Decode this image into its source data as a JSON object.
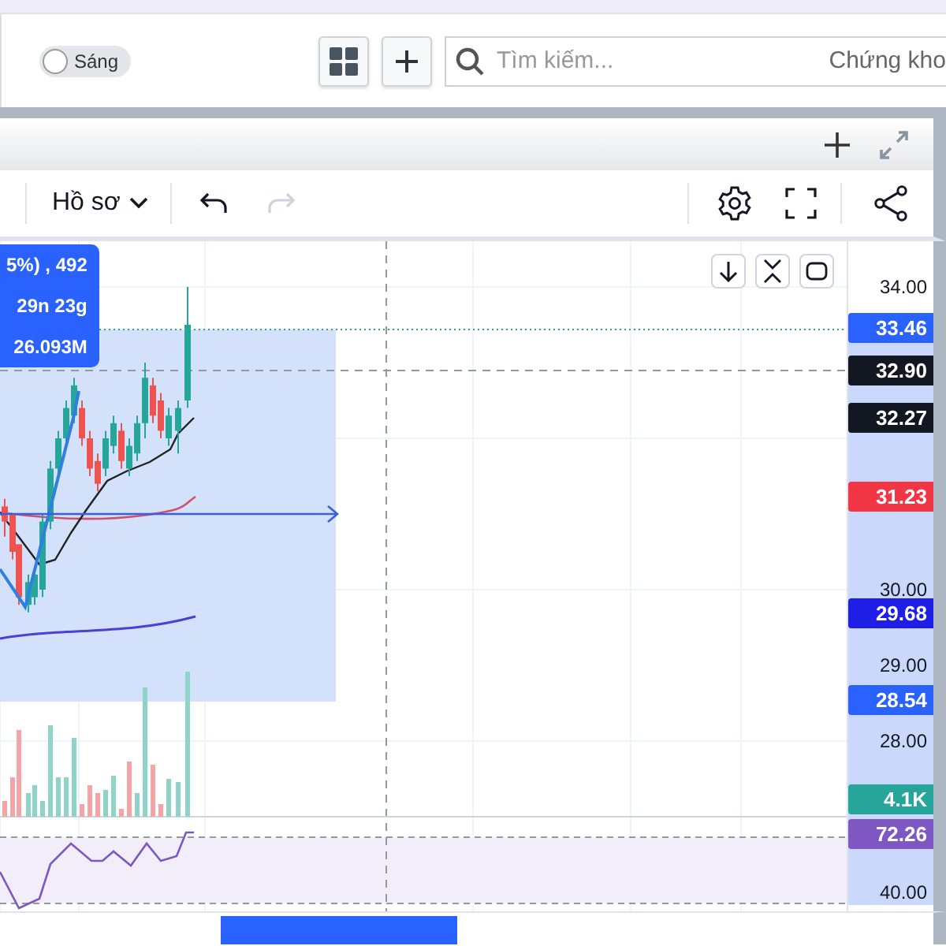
{
  "top_toolbar": {
    "theme_toggle": {
      "label": "Sáng",
      "on": false
    },
    "search": {
      "placeholder": "Tìm kiếm...",
      "text": "Chứng kho"
    }
  },
  "chart_toolbar": {
    "profile_menu": "Hồ sơ",
    "undo": {
      "disabled": false
    },
    "redo": {
      "disabled": true
    }
  },
  "tooltip": [
    "5%) , 492",
    "29n 23g",
    "26.093M"
  ],
  "price_axis": [
    {
      "kind": "price_tick",
      "text": "34.00"
    },
    {
      "kind": "price_tag",
      "text": "33.46",
      "color": "#2962ff"
    },
    {
      "kind": "price_tag",
      "text": "32.90",
      "color": "#131722"
    },
    {
      "kind": "price_tag",
      "text": "32.27",
      "color": "#131722"
    },
    {
      "kind": "price_tag",
      "text": "31.23",
      "color": "#f23645"
    },
    {
      "kind": "price_tick",
      "text": "30.00"
    },
    {
      "kind": "price_tag",
      "text": "29.68",
      "color": "#1e1ee6"
    },
    {
      "kind": "price_tick",
      "text": "29.00"
    },
    {
      "kind": "price_tag",
      "text": "28.54",
      "color": "#2962ff"
    },
    {
      "kind": "price_tick",
      "text": "28.00"
    },
    {
      "kind": "volume_tag",
      "text": "4.1K",
      "color": "#26a69a"
    },
    {
      "kind": "rsi_tag",
      "text": "72.26",
      "color": "#7e57c2"
    },
    {
      "kind": "rsi_tick",
      "text": "40.00"
    }
  ]
}
